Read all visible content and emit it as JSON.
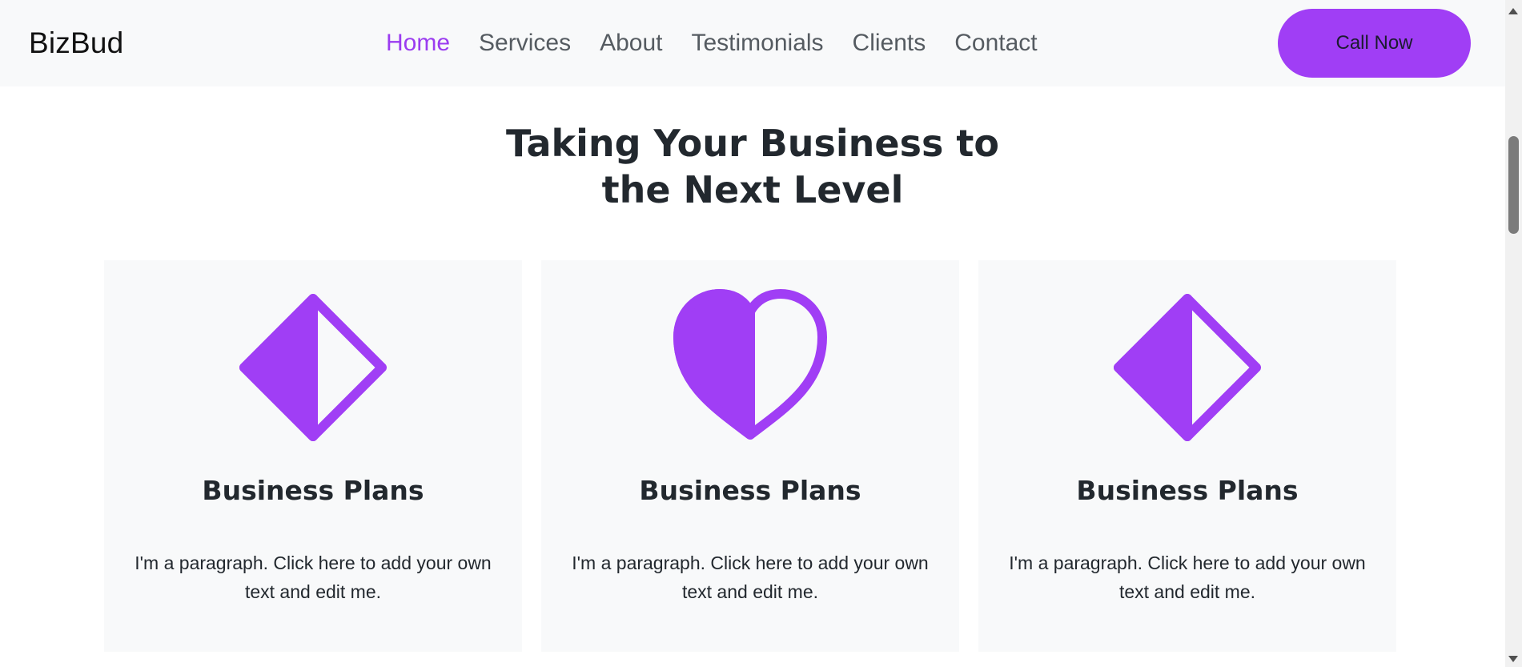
{
  "brand": "BizBud",
  "nav": {
    "items": [
      {
        "label": "Home",
        "active": true
      },
      {
        "label": "Services",
        "active": false
      },
      {
        "label": "About",
        "active": false
      },
      {
        "label": "Testimonials",
        "active": false
      },
      {
        "label": "Clients",
        "active": false
      },
      {
        "label": "Contact",
        "active": false
      }
    ],
    "cta_label": "Call Now"
  },
  "section": {
    "title_line1": "Taking Your Business to",
    "title_line2": "the Next Level"
  },
  "cards": [
    {
      "icon": "half-diamond-icon",
      "title": "Business Plans",
      "text": "I'm a paragraph. Click here to add your own text and edit me."
    },
    {
      "icon": "half-heart-icon",
      "title": "Business Plans",
      "text": "I'm a paragraph. Click here to add your own text and edit me."
    },
    {
      "icon": "half-diamond-icon",
      "title": "Business Plans",
      "text": "I'm a paragraph. Click here to add your own text and edit me."
    }
  ],
  "colors": {
    "accent": "#a03ef5",
    "nav_bg": "#f8f9fa",
    "text_dark": "#22282e",
    "nav_text": "#555b61"
  }
}
